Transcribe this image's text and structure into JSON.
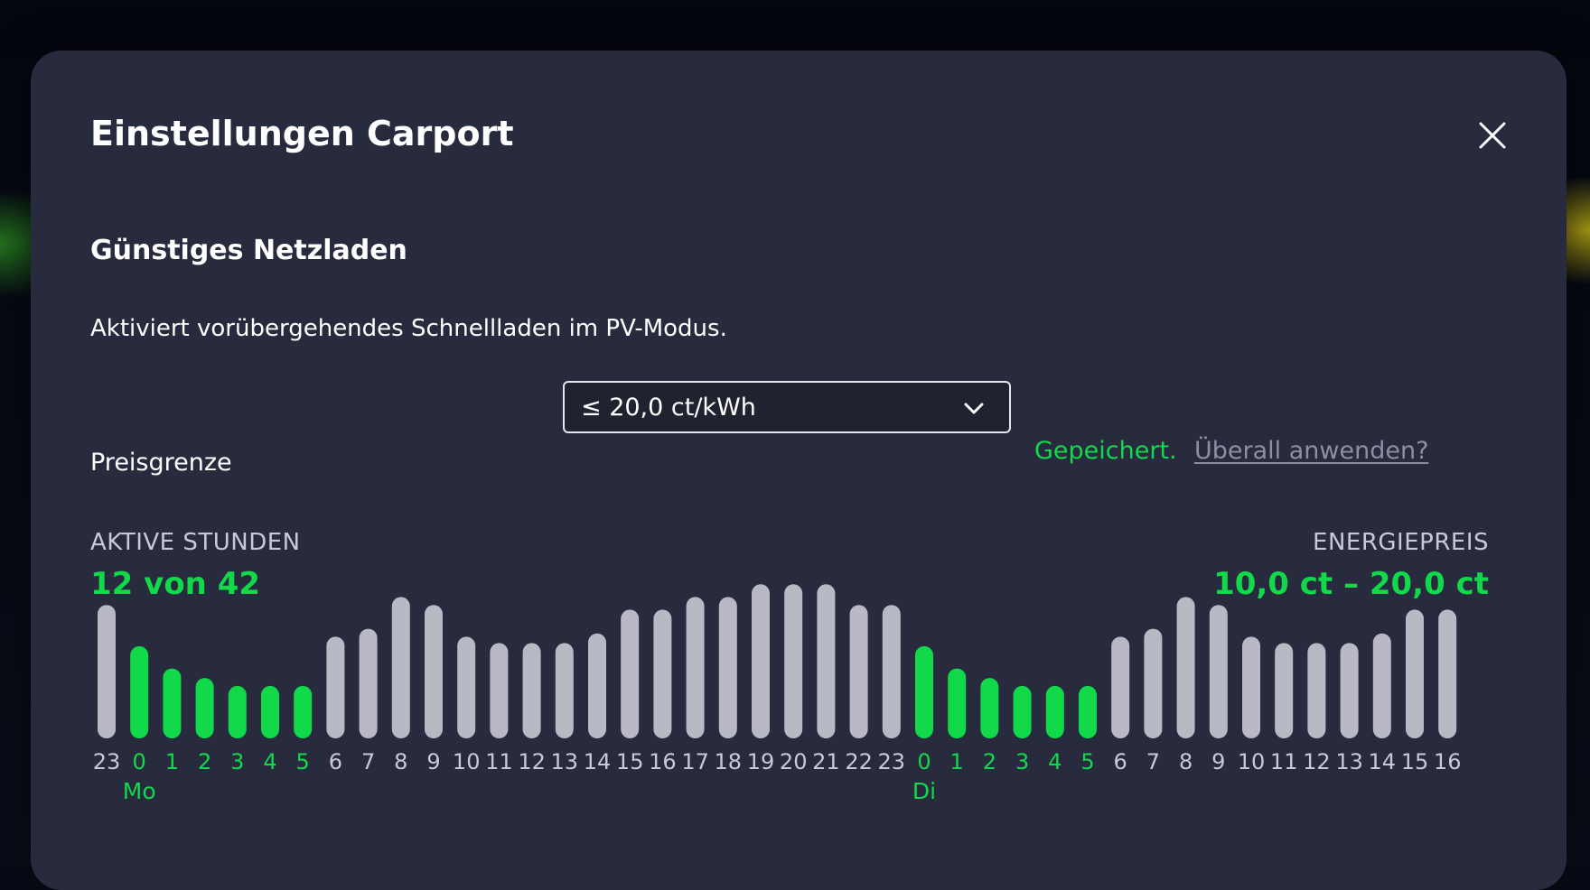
{
  "dialog": {
    "title": "Einstellungen Carport",
    "close_icon": "close-icon"
  },
  "section": {
    "title": "Günstiges Netzladen",
    "description": "Aktiviert vorübergehendes Schnellladen im PV-Modus."
  },
  "price_limit": {
    "label": "Preisgrenze",
    "selected": "≤ 20,0 ct/kWh",
    "dropdown_icon": "chevron-down-icon",
    "status": "Gepeichert.",
    "apply_all_link": "Überall anwenden?"
  },
  "summary": {
    "active_hours_label": "AKTIVE STUNDEN",
    "active_hours_value": "12 von 42",
    "energy_price_label": "ENERGIEPREIS",
    "energy_price_value": "10,0 ct – 20,0 ct"
  },
  "colors": {
    "active": "#12d94a",
    "inactive": "#b9b9c6",
    "tick_inactive": "#c9c9d6",
    "panel": "#282a3e"
  },
  "chart_data": {
    "type": "bar",
    "categories": [
      "23",
      "0",
      "1",
      "2",
      "3",
      "4",
      "5",
      "6",
      "7",
      "8",
      "9",
      "10",
      "11",
      "12",
      "13",
      "14",
      "15",
      "16",
      "17",
      "18",
      "19",
      "20",
      "21",
      "22",
      "23",
      "0",
      "1",
      "2",
      "3",
      "4",
      "5",
      "6",
      "7",
      "8",
      "9",
      "10",
      "11",
      "12",
      "13",
      "14",
      "15",
      "16"
    ],
    "values": [
      0.84,
      0.58,
      0.44,
      0.38,
      0.33,
      0.33,
      0.33,
      0.64,
      0.69,
      0.89,
      0.84,
      0.64,
      0.6,
      0.6,
      0.6,
      0.66,
      0.81,
      0.81,
      0.89,
      0.89,
      0.97,
      0.97,
      0.97,
      0.84,
      0.84,
      0.58,
      0.44,
      0.38,
      0.33,
      0.33,
      0.33,
      0.64,
      0.69,
      0.89,
      0.84,
      0.64,
      0.6,
      0.6,
      0.6,
      0.66,
      0.81,
      0.81
    ],
    "active": [
      false,
      true,
      true,
      true,
      true,
      true,
      true,
      false,
      false,
      false,
      false,
      false,
      false,
      false,
      false,
      false,
      false,
      false,
      false,
      false,
      false,
      false,
      false,
      false,
      false,
      true,
      true,
      true,
      true,
      true,
      true,
      false,
      false,
      false,
      false,
      false,
      false,
      false,
      false,
      false,
      false,
      false
    ],
    "day_labels": [
      {
        "index": 1,
        "label": "Mo"
      },
      {
        "index": 25,
        "label": "Di"
      }
    ],
    "title": "",
    "xlabel": "",
    "ylabel": "",
    "ylim": [
      0,
      1
    ],
    "grid": false
  }
}
